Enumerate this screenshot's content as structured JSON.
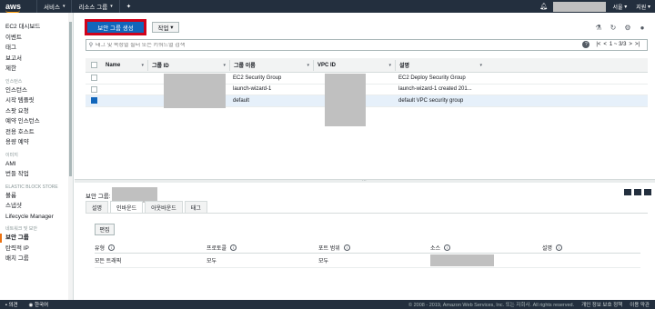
{
  "topbar": {
    "logo": "aws",
    "services": "서비스",
    "resource_groups": "리소스 그룹",
    "pin_icon": "pin-icon",
    "region": "서울",
    "support": "지원"
  },
  "sidebar": {
    "items_top": [
      "EC2 대시보드",
      "이벤트",
      "태그",
      "보고서",
      "제한"
    ],
    "section_instances": "인스턴스",
    "items_instances": [
      "인스턴스",
      "시작 템플릿",
      "스팟 요청",
      "예약 인스턴스",
      "전용 호스트",
      "용량 예약"
    ],
    "section_images": "이미지",
    "items_images": [
      "AMI",
      "번들 작업"
    ],
    "section_ebs": "ELASTIC BLOCK STORE",
    "items_ebs": [
      "볼륨",
      "스냅샷",
      "Lifecycle Manager"
    ],
    "section_network": "네트워크 및 보안",
    "items_network": [
      "보안 그룹",
      "탄력적 IP",
      "배치 그룹"
    ]
  },
  "toolbar": {
    "create_button": "보안 그룹 생성",
    "action_button": "작업"
  },
  "search": {
    "placeholder": "태그 및 속성별 필터 또는 키워드별 검색",
    "pagination": "1 ~ 3/3"
  },
  "table": {
    "headers": [
      "Name",
      "그룹 ID",
      "그룹 이름",
      "VPC ID",
      "설명"
    ],
    "rows": [
      {
        "name": "",
        "group_name": "EC2 Security Group",
        "description": "EC2 Deploy Security Group",
        "selected": false
      },
      {
        "name": "",
        "group_name": "launch-wizard-1",
        "description": "launch-wizard-1 created 201...",
        "selected": false
      },
      {
        "name": "",
        "group_name": "default",
        "description": "default VPC security group",
        "selected": true
      }
    ]
  },
  "details": {
    "title": "보안 그룹:",
    "tabs": [
      "설명",
      "인바운드",
      "아웃바운드",
      "태그"
    ],
    "active_tab": "인바운드",
    "edit_button": "편집",
    "rule_headers": [
      "유형",
      "프로토콜",
      "포트 범위",
      "소스",
      "설명"
    ],
    "rules": [
      {
        "type": "모든 트래픽",
        "protocol": "모두",
        "port_range": "모두",
        "source": "",
        "description": ""
      }
    ]
  },
  "footer": {
    "feedback": "의견",
    "language": "한국어",
    "copyright": "© 2008 - 2019, Amazon Web Services, Inc. 또는 자회사. All rights reserved.",
    "privacy": "개인 정보 보호 정책",
    "terms": "이용 약관"
  },
  "colors": {
    "topbar": "#232f3e",
    "primary": "#1166bb",
    "highlight_border": "#d0021b",
    "active_indicator": "#ec7211"
  }
}
